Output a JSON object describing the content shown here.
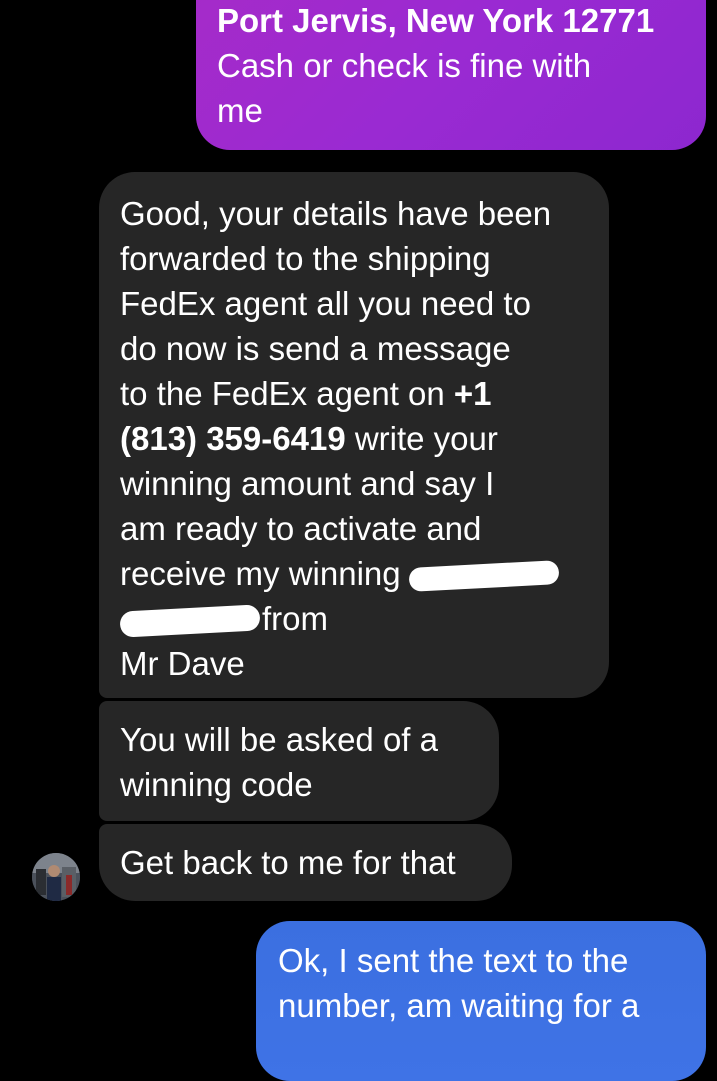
{
  "messages": [
    {
      "id": "out-top",
      "direction": "outgoing",
      "lines": [
        {
          "text": "Port Jervis, New York 12771",
          "bold": true
        },
        {
          "text": "Cash or check is fine with"
        },
        {
          "text": "me"
        }
      ]
    },
    {
      "id": "in-1",
      "direction": "incoming",
      "line1": "Good, your details have been",
      "line2": "forwarded to the shipping",
      "line3": "FedEx agent all you need to",
      "line4": "do now is send a message",
      "line5_a": "to the FedEx agent on ",
      "line5_b": "+1",
      "line6_a": "(813) 359-6419",
      "line6_b": " write your",
      "line7": "winning amount and say I",
      "line8": "am ready to activate and",
      "line9": "receive my winning",
      "line10": "from",
      "line11": "Mr Dave"
    },
    {
      "id": "in-2",
      "direction": "incoming",
      "line1": "You will be asked of a",
      "line2": "winning code"
    },
    {
      "id": "in-3",
      "direction": "incoming",
      "line1": "Get back to me for that"
    },
    {
      "id": "out-bottom",
      "direction": "outgoing",
      "line1": "Ok, I sent the text to the",
      "line2": "number, am waiting for a"
    }
  ],
  "colors": {
    "background": "#000000",
    "outgoing_purple": "#9a2ad2",
    "outgoing_blue": "#3f73e6",
    "incoming_gray": "#262626",
    "text": "#ffffff"
  },
  "avatar": {
    "icon": "contact-avatar-photo"
  }
}
